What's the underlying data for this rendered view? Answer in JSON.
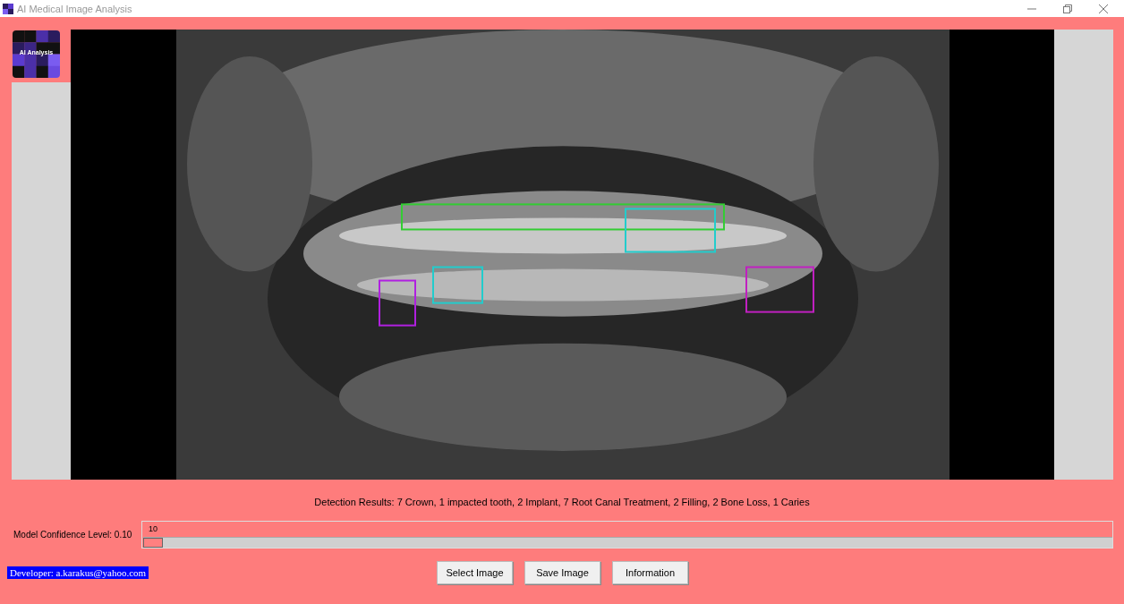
{
  "window": {
    "title": "AI Medical Image Analysis"
  },
  "logo": {
    "label": "AI Analysis"
  },
  "detection_results": "Detection Results: 7 Crown, 1 impacted tooth, 2 Implant, 7 Root Canal Treatment, 2 Filling, 2 Bone Loss, 1 Caries",
  "confidence": {
    "label": "Model Confidence Level: 0.10",
    "value": "10",
    "level": 0
  },
  "developer": "Developer: a.karakus@yahoo.com",
  "buttons": [
    "Select Image",
    "Save Image",
    "Information"
  ]
}
